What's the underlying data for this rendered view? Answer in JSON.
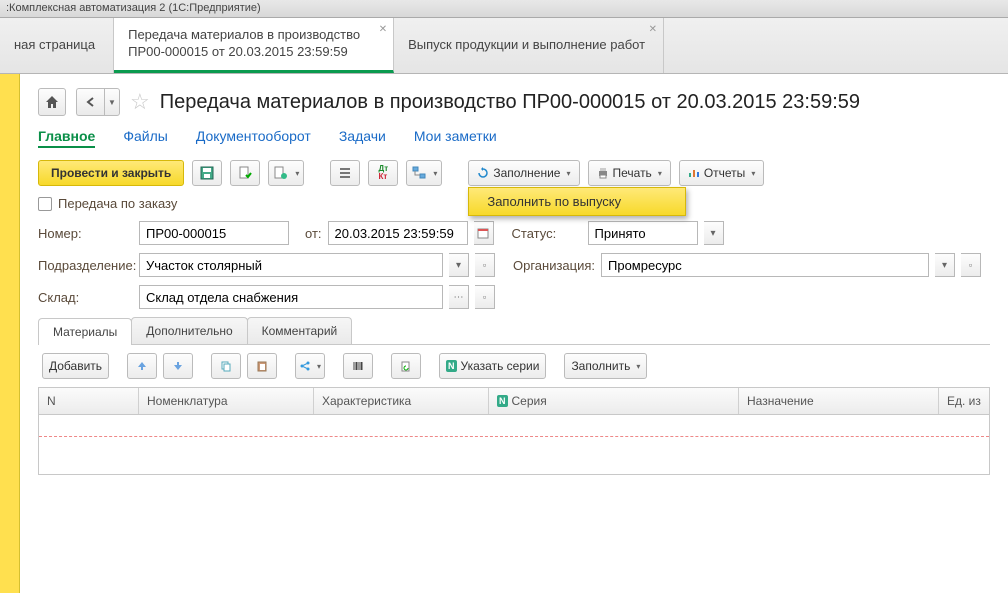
{
  "window_title": ":Комплексная автоматизация 2  (1С:Предприятие)",
  "tabs": [
    {
      "label": "ная страница"
    },
    {
      "label": "Передача материалов в производство ПР00-000015 от 20.03.2015 23:59:59",
      "active": true
    },
    {
      "label": "Выпуск продукции и выполнение работ"
    }
  ],
  "page_title": "Передача материалов в производство ПР00-000015 от 20.03.2015 23:59:59",
  "nav_tabs": [
    {
      "label": "Главное",
      "active": true
    },
    {
      "label": "Файлы"
    },
    {
      "label": "Документооборот"
    },
    {
      "label": "Задачи"
    },
    {
      "label": "Мои заметки"
    }
  ],
  "toolbar": {
    "post_and_close": "Провести и закрыть",
    "fill": "Заполнение",
    "print": "Печать",
    "reports": "Отчеты",
    "fill_menu_item": "Заполнить по выпуску"
  },
  "checkbox_label": "Передача по заказу",
  "fields": {
    "number_label": "Номер:",
    "number_value": "ПР00-000015",
    "from_label": "от:",
    "date_value": "20.03.2015 23:59:59",
    "status_label": "Статус:",
    "status_value": "Принято",
    "dept_label": "Подразделение:",
    "dept_value": "Участок столярный",
    "org_label": "Организация:",
    "org_value": "Промресурс",
    "warehouse_label": "Склад:",
    "warehouse_value": "Склад отдела снабжения"
  },
  "sub_tabs": [
    {
      "label": "Материалы",
      "active": true
    },
    {
      "label": "Дополнительно"
    },
    {
      "label": "Комментарий"
    }
  ],
  "grid_toolbar": {
    "add": "Добавить",
    "series": "Указать серии",
    "fill": "Заполнить"
  },
  "grid_columns": [
    "N",
    "Номенклатура",
    "Характеристика",
    "Серия",
    "Назначение",
    "Ед. из"
  ]
}
